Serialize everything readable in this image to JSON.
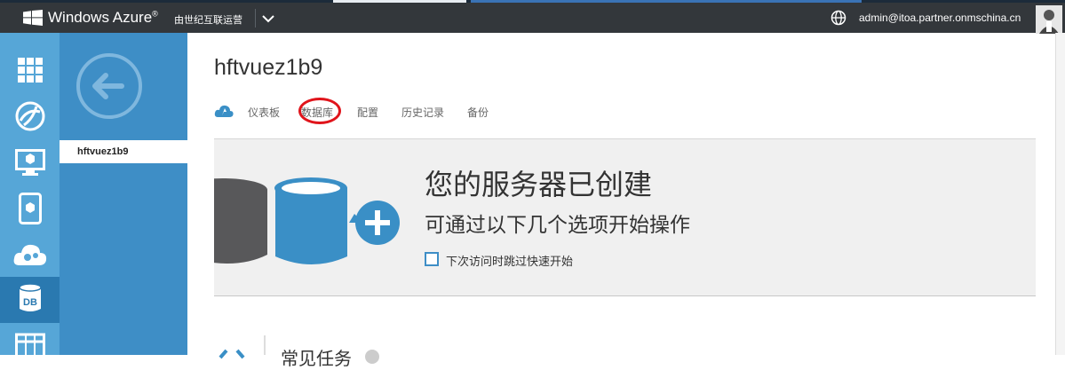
{
  "header": {
    "brand": "Windows Azure",
    "brand_mark": "®",
    "tenant": "由世纪互联运营",
    "user_email": "admin@itoa.partner.onmschina.cn"
  },
  "sidebar": {
    "items": [
      {
        "icon": "all-items-icon"
      },
      {
        "icon": "web-sites-icon"
      },
      {
        "icon": "virtual-machines-icon"
      },
      {
        "icon": "mobile-services-icon"
      },
      {
        "icon": "cloud-services-icon"
      },
      {
        "icon": "sql-databases-icon",
        "label": "DB",
        "active": true
      },
      {
        "icon": "storage-icon"
      }
    ]
  },
  "list": {
    "selected_item": "hftvuez1b9"
  },
  "main": {
    "title": "hftvuez1b9",
    "tabs": [
      {
        "label": "仪表板"
      },
      {
        "label": "数据库"
      },
      {
        "label": "配置"
      },
      {
        "label": "历史记录"
      },
      {
        "label": "备份"
      }
    ],
    "quickstart": {
      "headline": "您的服务器已创建",
      "subline": "可通过以下几个选项开始操作",
      "skip_label": "下次访问时跳过快速开始"
    },
    "common_tasks": "常见任务"
  },
  "colors": {
    "header_bg": "#33373b",
    "nav_bg": "#56a6d7",
    "nav_active": "#2a79b0",
    "list_bg": "#3e8ec6",
    "annotation_circle": "#e0141b",
    "db_dark": "#58585a",
    "db_blue": "#3a8fc6"
  }
}
